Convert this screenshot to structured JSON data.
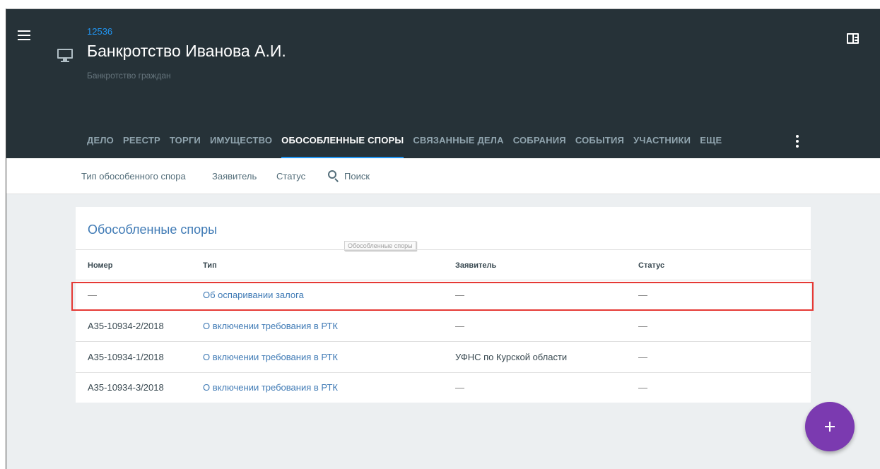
{
  "header": {
    "case_number": "12536",
    "case_title": "Банкротство Иванова А.И.",
    "case_subtitle": "Банкротство граждан",
    "accent_color": "#2196f3",
    "background_color": "#263238"
  },
  "tabs": [
    {
      "label": "ДЕЛО"
    },
    {
      "label": "РЕЕСТР"
    },
    {
      "label": "ТОРГИ"
    },
    {
      "label": "ИМУЩЕСТВО"
    },
    {
      "label": "ОБОСОБЛЕННЫЕ СПОРЫ",
      "active": true
    },
    {
      "label": "СВЯЗАННЫЕ ДЕЛА"
    },
    {
      "label": "СОБРАНИЯ"
    },
    {
      "label": "СОБЫТИЯ"
    },
    {
      "label": "УЧАСТНИКИ"
    },
    {
      "label": "ЕЩЕ"
    }
  ],
  "filters": {
    "type": "Тип обособенного спора",
    "applicant": "Заявитель",
    "status": "Статус",
    "search": "Поиск"
  },
  "card": {
    "title": "Обособленные споры",
    "tooltip": "Обособленные споры",
    "columns": [
      "Номер",
      "Тип",
      "Заявитель",
      "Статус"
    ],
    "rows": [
      {
        "number": "—",
        "type": "Об оспаривании залога",
        "applicant": "—",
        "status": "—",
        "highlighted": true
      },
      {
        "number": "А35-10934-2/2018",
        "type": "О включении требования в РТК",
        "applicant": "—",
        "status": "—"
      },
      {
        "number": "А35-10934-1/2018",
        "type": "О включении требования в РТК",
        "applicant": "УФНС по Курской области",
        "status": "—"
      },
      {
        "number": "А35-10934-3/2018",
        "type": "О включении требования в РТК",
        "applicant": "—",
        "status": "—"
      }
    ]
  },
  "icons": {
    "menu": "hamburger-menu-icon",
    "case": "monitor-icon",
    "panel": "side-panel-icon",
    "more": "more-vertical-icon",
    "search": "search-icon",
    "add": "plus-icon"
  },
  "fab_color": "#7b3ab0"
}
